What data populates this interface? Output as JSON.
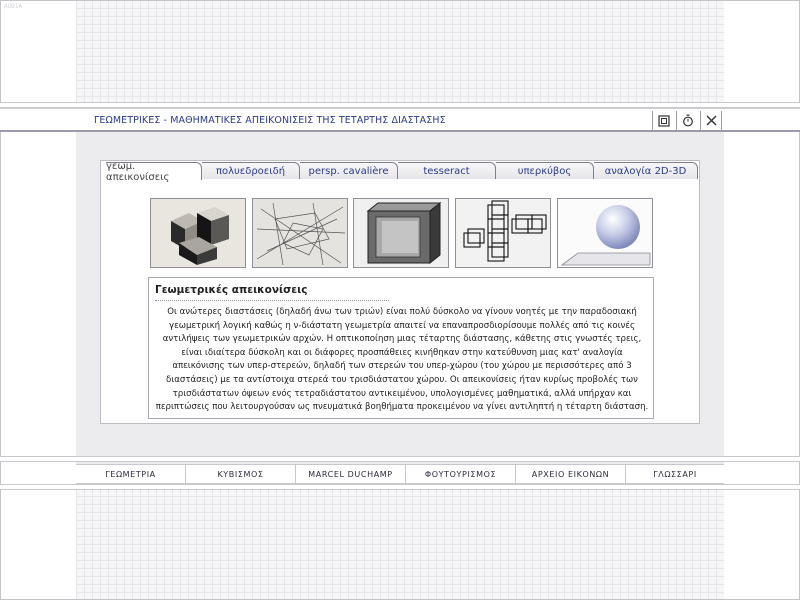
{
  "corner_label": "AUD1A",
  "window": {
    "title": "ΓΕΩΜΕΤΡΙΚΕΣ - ΜΑΘΗΜΑΤΙΚΕΣ ΑΠΕΙΚΟΝΙΣΕΙΣ ΤΗΣ ΤΕΤΑΡΤΗΣ ΔΙΑΣΤΑΣΗΣ",
    "controls": [
      "window-icon",
      "timer-icon",
      "close-icon"
    ]
  },
  "tabs": [
    {
      "label": "γεωμ. απεικονίσεις",
      "active": true
    },
    {
      "label": "πολυεδροειδή",
      "active": false
    },
    {
      "label": "persp. cavalière",
      "active": false
    },
    {
      "label": "tesseract",
      "active": false
    },
    {
      "label": "υπερκύβος",
      "active": false
    },
    {
      "label": "αναλογία 2D-3D",
      "active": false
    }
  ],
  "thumbnails": [
    "cube-sculpture-thumbnail",
    "line-drawing-thumbnail",
    "shaded-cube-thumbnail",
    "cross-cubes-thumbnail",
    "sphere-thumbnail"
  ],
  "article": {
    "title": "Γεωμετρικές απεικονίσεις",
    "body": "Οι ανώτερες διαστάσεις (δηλαδή άνω των τριών) είναι πολύ δύσκολο να γίνουν νοητές με την παραδοσιακή γεωμετρική λογική καθώς η ν-διάστατη γεωμετρία απαιτεί να επαναπροσδιορίσουμε πολλές από τις κοινές αντιλήψεις των γεωμετρικών αρχών. Η οπτικοποίηση μιας τέταρτης διάστασης, κάθετης στις γνωστές τρεις, είναι ιδιαίτερα δύσκολη και οι διάφορες προσπάθειες κινήθηκαν στην κατεύθυνση μιας κατ' αναλογία απεικόνισης των υπερ-στερεών, δηλαδή των στερεών του υπερ-χώρου (του χώρου με περισσότερες από 3 διαστάσεις) με τα αντίστοιχα στερεά του τρισδιάστατου χώρου. Οι απεικονίσεις ήταν κυρίως προβολές των τρισδιάστατων όψεων ενός τετραδιάστατου αντικειμένου, υπολογισμένες μαθηματικά, αλλά υπήρχαν και περιπτώσεις που λειτουργούσαν ως πνευματικά βοηθήματα προκειμένου να γίνει αντιληπτή η τέταρτη διάσταση."
  },
  "nav": [
    {
      "label": "ΓΕΩΜΕΤΡΙΑ"
    },
    {
      "label": "ΚΥΒΙΣΜΟΣ"
    },
    {
      "label": "MARCEL DUCHAMP"
    },
    {
      "label": "ΦΟΥΤΟΥΡΙΣΜΟΣ"
    },
    {
      "label": "ΑΡΧΕΙΟ ΕΙΚΟΝΩΝ"
    },
    {
      "label": "ΓΛΩΣΣΑΡΙ"
    }
  ]
}
